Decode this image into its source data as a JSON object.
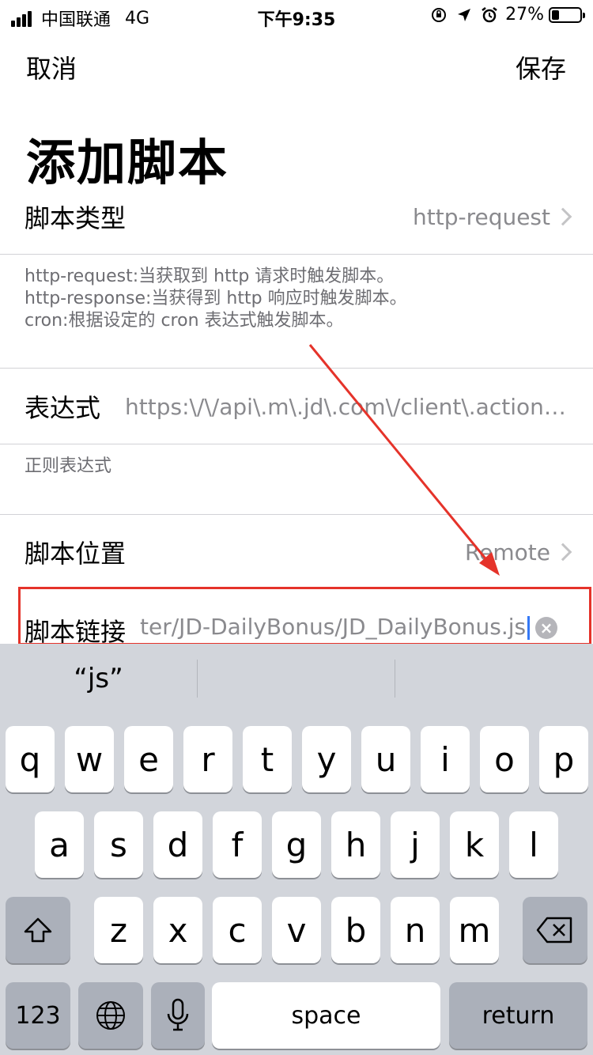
{
  "status_bar": {
    "carrier": "中国联通",
    "network": "4G",
    "time": "下午9:35",
    "battery_percent": "27%",
    "battery_level": 0.27,
    "icons": [
      "signal-icon",
      "rotation-lock-icon",
      "location-icon",
      "alarm-icon",
      "battery-icon"
    ]
  },
  "nav": {
    "cancel_label": "取消",
    "save_label": "保存"
  },
  "title": "添加脚本",
  "script_type": {
    "label": "脚本类型",
    "value": "http-request",
    "help_lines": [
      "http-request:当获取到 http 请求时触发脚本。",
      "http-response:当获得到 http 响应时触发脚本。",
      "cron:根据设定的 cron 表达式触发脚本。"
    ]
  },
  "expression": {
    "label": "表达式",
    "value": "https:\\/\\/api\\.m\\.jd\\.com\\/client\\.action.*…",
    "help": "正则表达式"
  },
  "script_location": {
    "label": "脚本位置",
    "value": "Remote"
  },
  "script_link": {
    "label": "脚本链接",
    "value": "ter/JD-DailyBonus/JD_DailyBonus.js"
  },
  "annotation_color": "#e5332a",
  "keyboard": {
    "suggestions": [
      "“js”",
      "",
      ""
    ],
    "row1": [
      "q",
      "w",
      "e",
      "r",
      "t",
      "y",
      "u",
      "i",
      "o",
      "p"
    ],
    "row2": [
      "a",
      "s",
      "d",
      "f",
      "g",
      "h",
      "j",
      "k",
      "l"
    ],
    "row3": [
      "z",
      "x",
      "c",
      "v",
      "b",
      "n",
      "m"
    ],
    "numbers_label": "123",
    "space_label": "space",
    "return_label": "return"
  }
}
